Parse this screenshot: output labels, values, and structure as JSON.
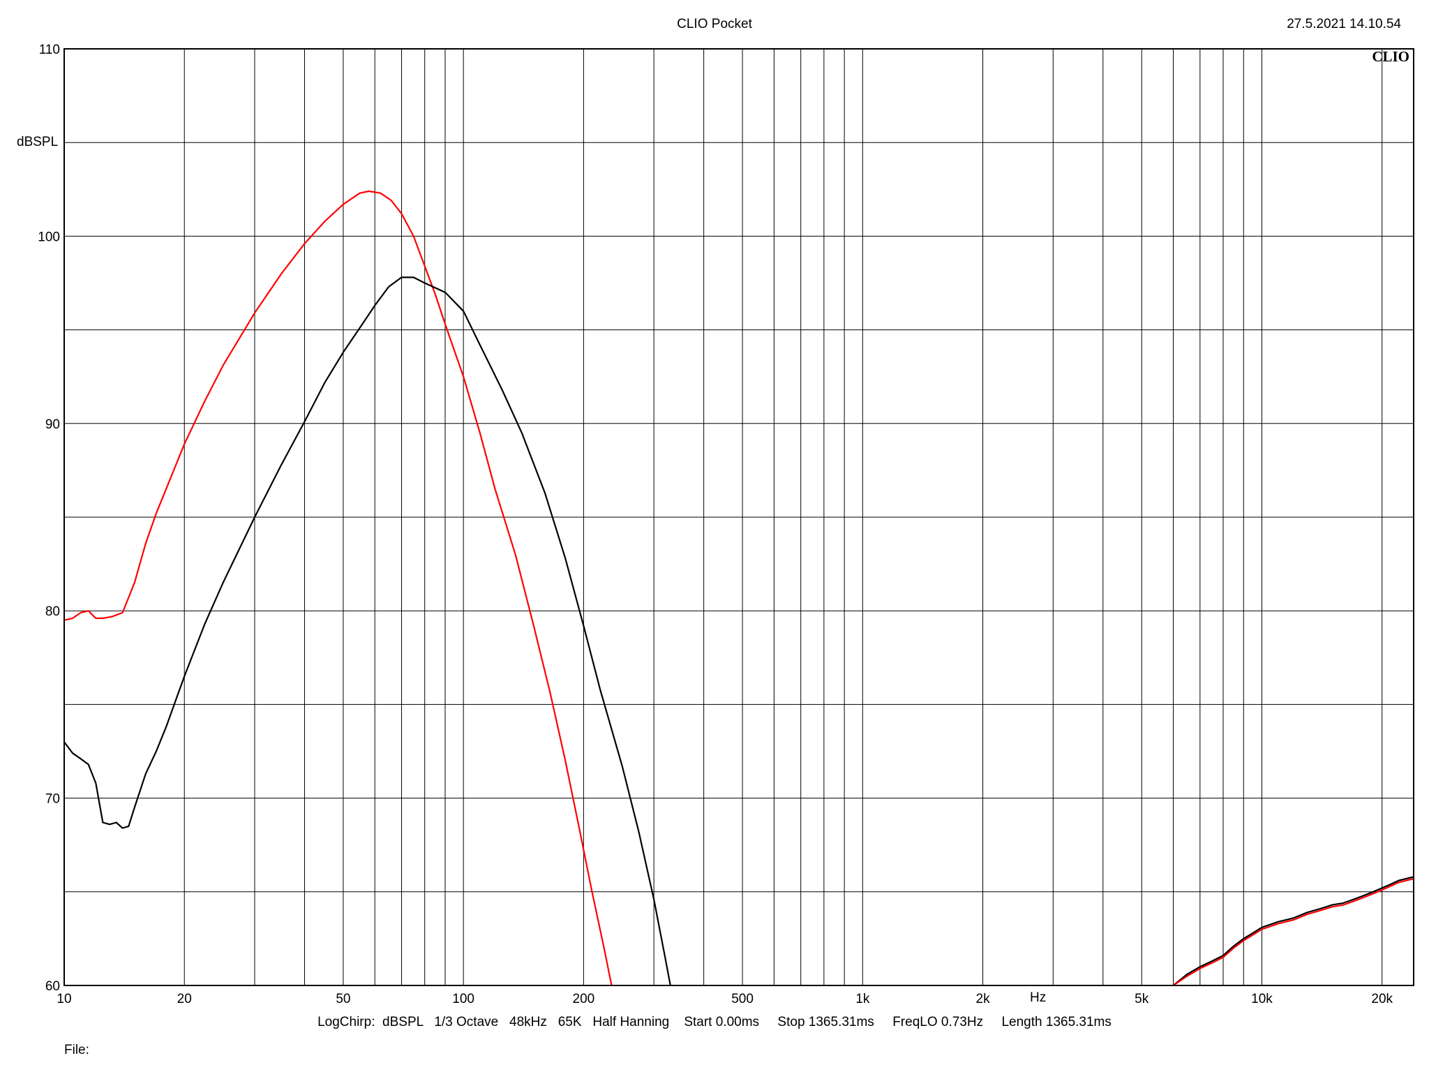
{
  "header": {
    "title": "CLIO Pocket",
    "timestamp": "27.5.2021 14.10.54"
  },
  "logo_text": "CLIO",
  "footer": {
    "settings": "LogChirp:  dBSPL   1/3 Octave   48kHz   65K   Half Hanning    Start 0.00ms     Stop 1365.31ms     FreqLO 0.73Hz     Length 1365.31ms",
    "file_label": "File:"
  },
  "chart_data": {
    "type": "line",
    "ylabel": "dBSPL",
    "xlabel": "Hz",
    "x_scale": "log",
    "xlim": [
      10,
      24000
    ],
    "ylim": [
      60,
      110
    ],
    "grid": true,
    "x_ticks": [
      {
        "value": 10,
        "label": "10"
      },
      {
        "value": 20,
        "label": "20"
      },
      {
        "value": 50,
        "label": "50"
      },
      {
        "value": 100,
        "label": "100"
      },
      {
        "value": 200,
        "label": "200"
      },
      {
        "value": 500,
        "label": "500"
      },
      {
        "value": 1000,
        "label": "1k"
      },
      {
        "value": 2000,
        "label": "2k"
      },
      {
        "value": 5000,
        "label": "5k"
      },
      {
        "value": 10000,
        "label": "10k"
      },
      {
        "value": 20000,
        "label": "20k"
      }
    ],
    "y_ticks": [
      {
        "value": 60,
        "label": "60"
      },
      {
        "value": 70,
        "label": "70"
      },
      {
        "value": 80,
        "label": "80"
      },
      {
        "value": 90,
        "label": "90"
      },
      {
        "value": 100,
        "label": "100"
      },
      {
        "value": 110,
        "label": "110"
      }
    ],
    "series": [
      {
        "color": "#ff0000",
        "points": [
          [
            10,
            79.5
          ],
          [
            10.5,
            79.6
          ],
          [
            11,
            79.9
          ],
          [
            11.5,
            80.0
          ],
          [
            12,
            79.6
          ],
          [
            12.5,
            79.6
          ],
          [
            13.2,
            79.7
          ],
          [
            14,
            79.9
          ],
          [
            15,
            81.5
          ],
          [
            16,
            83.6
          ],
          [
            17,
            85.2
          ],
          [
            18,
            86.5
          ],
          [
            20,
            88.9
          ],
          [
            22.5,
            91.2
          ],
          [
            25,
            93.1
          ],
          [
            30,
            95.9
          ],
          [
            35,
            98.0
          ],
          [
            40,
            99.6
          ],
          [
            45,
            100.8
          ],
          [
            50,
            101.7
          ],
          [
            55,
            102.3
          ],
          [
            58,
            102.4
          ],
          [
            62,
            102.3
          ],
          [
            66,
            101.9
          ],
          [
            70,
            101.2
          ],
          [
            75,
            100.0
          ],
          [
            80,
            98.4
          ],
          [
            85,
            96.9
          ],
          [
            90,
            95.3
          ],
          [
            100,
            92.5
          ],
          [
            110,
            89.5
          ],
          [
            120,
            86.5
          ],
          [
            135,
            83.0
          ],
          [
            150,
            79.2
          ],
          [
            165,
            75.6
          ],
          [
            180,
            72.0
          ],
          [
            195,
            68.4
          ],
          [
            210,
            65.0
          ],
          [
            225,
            62.0
          ],
          [
            235,
            60.0
          ]
        ]
      },
      {
        "color": "#000000",
        "points": [
          [
            10,
            73.0
          ],
          [
            10.5,
            72.4
          ],
          [
            11,
            72.1
          ],
          [
            11.5,
            71.8
          ],
          [
            12,
            70.8
          ],
          [
            12.5,
            68.7
          ],
          [
            13,
            68.6
          ],
          [
            13.5,
            68.7
          ],
          [
            14,
            68.4
          ],
          [
            14.5,
            68.5
          ],
          [
            15,
            69.5
          ],
          [
            16,
            71.3
          ],
          [
            17,
            72.5
          ],
          [
            18,
            73.8
          ],
          [
            20,
            76.5
          ],
          [
            22.5,
            79.3
          ],
          [
            25,
            81.5
          ],
          [
            30,
            85.0
          ],
          [
            35,
            87.8
          ],
          [
            40,
            90.1
          ],
          [
            45,
            92.2
          ],
          [
            50,
            93.8
          ],
          [
            55,
            95.1
          ],
          [
            60,
            96.3
          ],
          [
            65,
            97.3
          ],
          [
            70,
            97.8
          ],
          [
            75,
            97.8
          ],
          [
            80,
            97.5
          ],
          [
            90,
            97.0
          ],
          [
            100,
            96.0
          ],
          [
            110,
            94.2
          ],
          [
            125,
            91.8
          ],
          [
            140,
            89.5
          ],
          [
            160,
            86.3
          ],
          [
            180,
            82.8
          ],
          [
            200,
            79.2
          ],
          [
            220,
            75.8
          ],
          [
            250,
            71.7
          ],
          [
            275,
            68.2
          ],
          [
            300,
            64.6
          ],
          [
            320,
            61.5
          ],
          [
            330,
            60.0
          ]
        ]
      },
      {
        "color": "#000000",
        "points": [
          [
            6000,
            60.0
          ],
          [
            6500,
            60.6
          ],
          [
            7000,
            61.0
          ],
          [
            7500,
            61.3
          ],
          [
            8000,
            61.6
          ],
          [
            8500,
            62.1
          ],
          [
            9000,
            62.5
          ],
          [
            9500,
            62.8
          ],
          [
            10000,
            63.1
          ],
          [
            11000,
            63.4
          ],
          [
            12000,
            63.6
          ],
          [
            13000,
            63.9
          ],
          [
            14000,
            64.1
          ],
          [
            15000,
            64.3
          ],
          [
            16000,
            64.4
          ],
          [
            17000,
            64.6
          ],
          [
            18000,
            64.8
          ],
          [
            19000,
            65.0
          ],
          [
            20000,
            65.2
          ],
          [
            21000,
            65.4
          ],
          [
            22000,
            65.6
          ],
          [
            23000,
            65.7
          ],
          [
            24000,
            65.8
          ]
        ]
      },
      {
        "color": "#ff0000",
        "points": [
          [
            6000,
            60.0
          ],
          [
            6500,
            60.5
          ],
          [
            7000,
            60.9
          ],
          [
            7500,
            61.2
          ],
          [
            8000,
            61.5
          ],
          [
            8500,
            62.0
          ],
          [
            9000,
            62.4
          ],
          [
            9500,
            62.7
          ],
          [
            10000,
            63.0
          ],
          [
            11000,
            63.3
          ],
          [
            12000,
            63.5
          ],
          [
            13000,
            63.8
          ],
          [
            14000,
            64.0
          ],
          [
            15000,
            64.2
          ],
          [
            16000,
            64.3
          ],
          [
            17000,
            64.5
          ],
          [
            18000,
            64.7
          ],
          [
            19000,
            64.9
          ],
          [
            20000,
            65.1
          ],
          [
            21000,
            65.3
          ],
          [
            22000,
            65.5
          ],
          [
            23000,
            65.6
          ],
          [
            24000,
            65.7
          ]
        ]
      }
    ]
  }
}
